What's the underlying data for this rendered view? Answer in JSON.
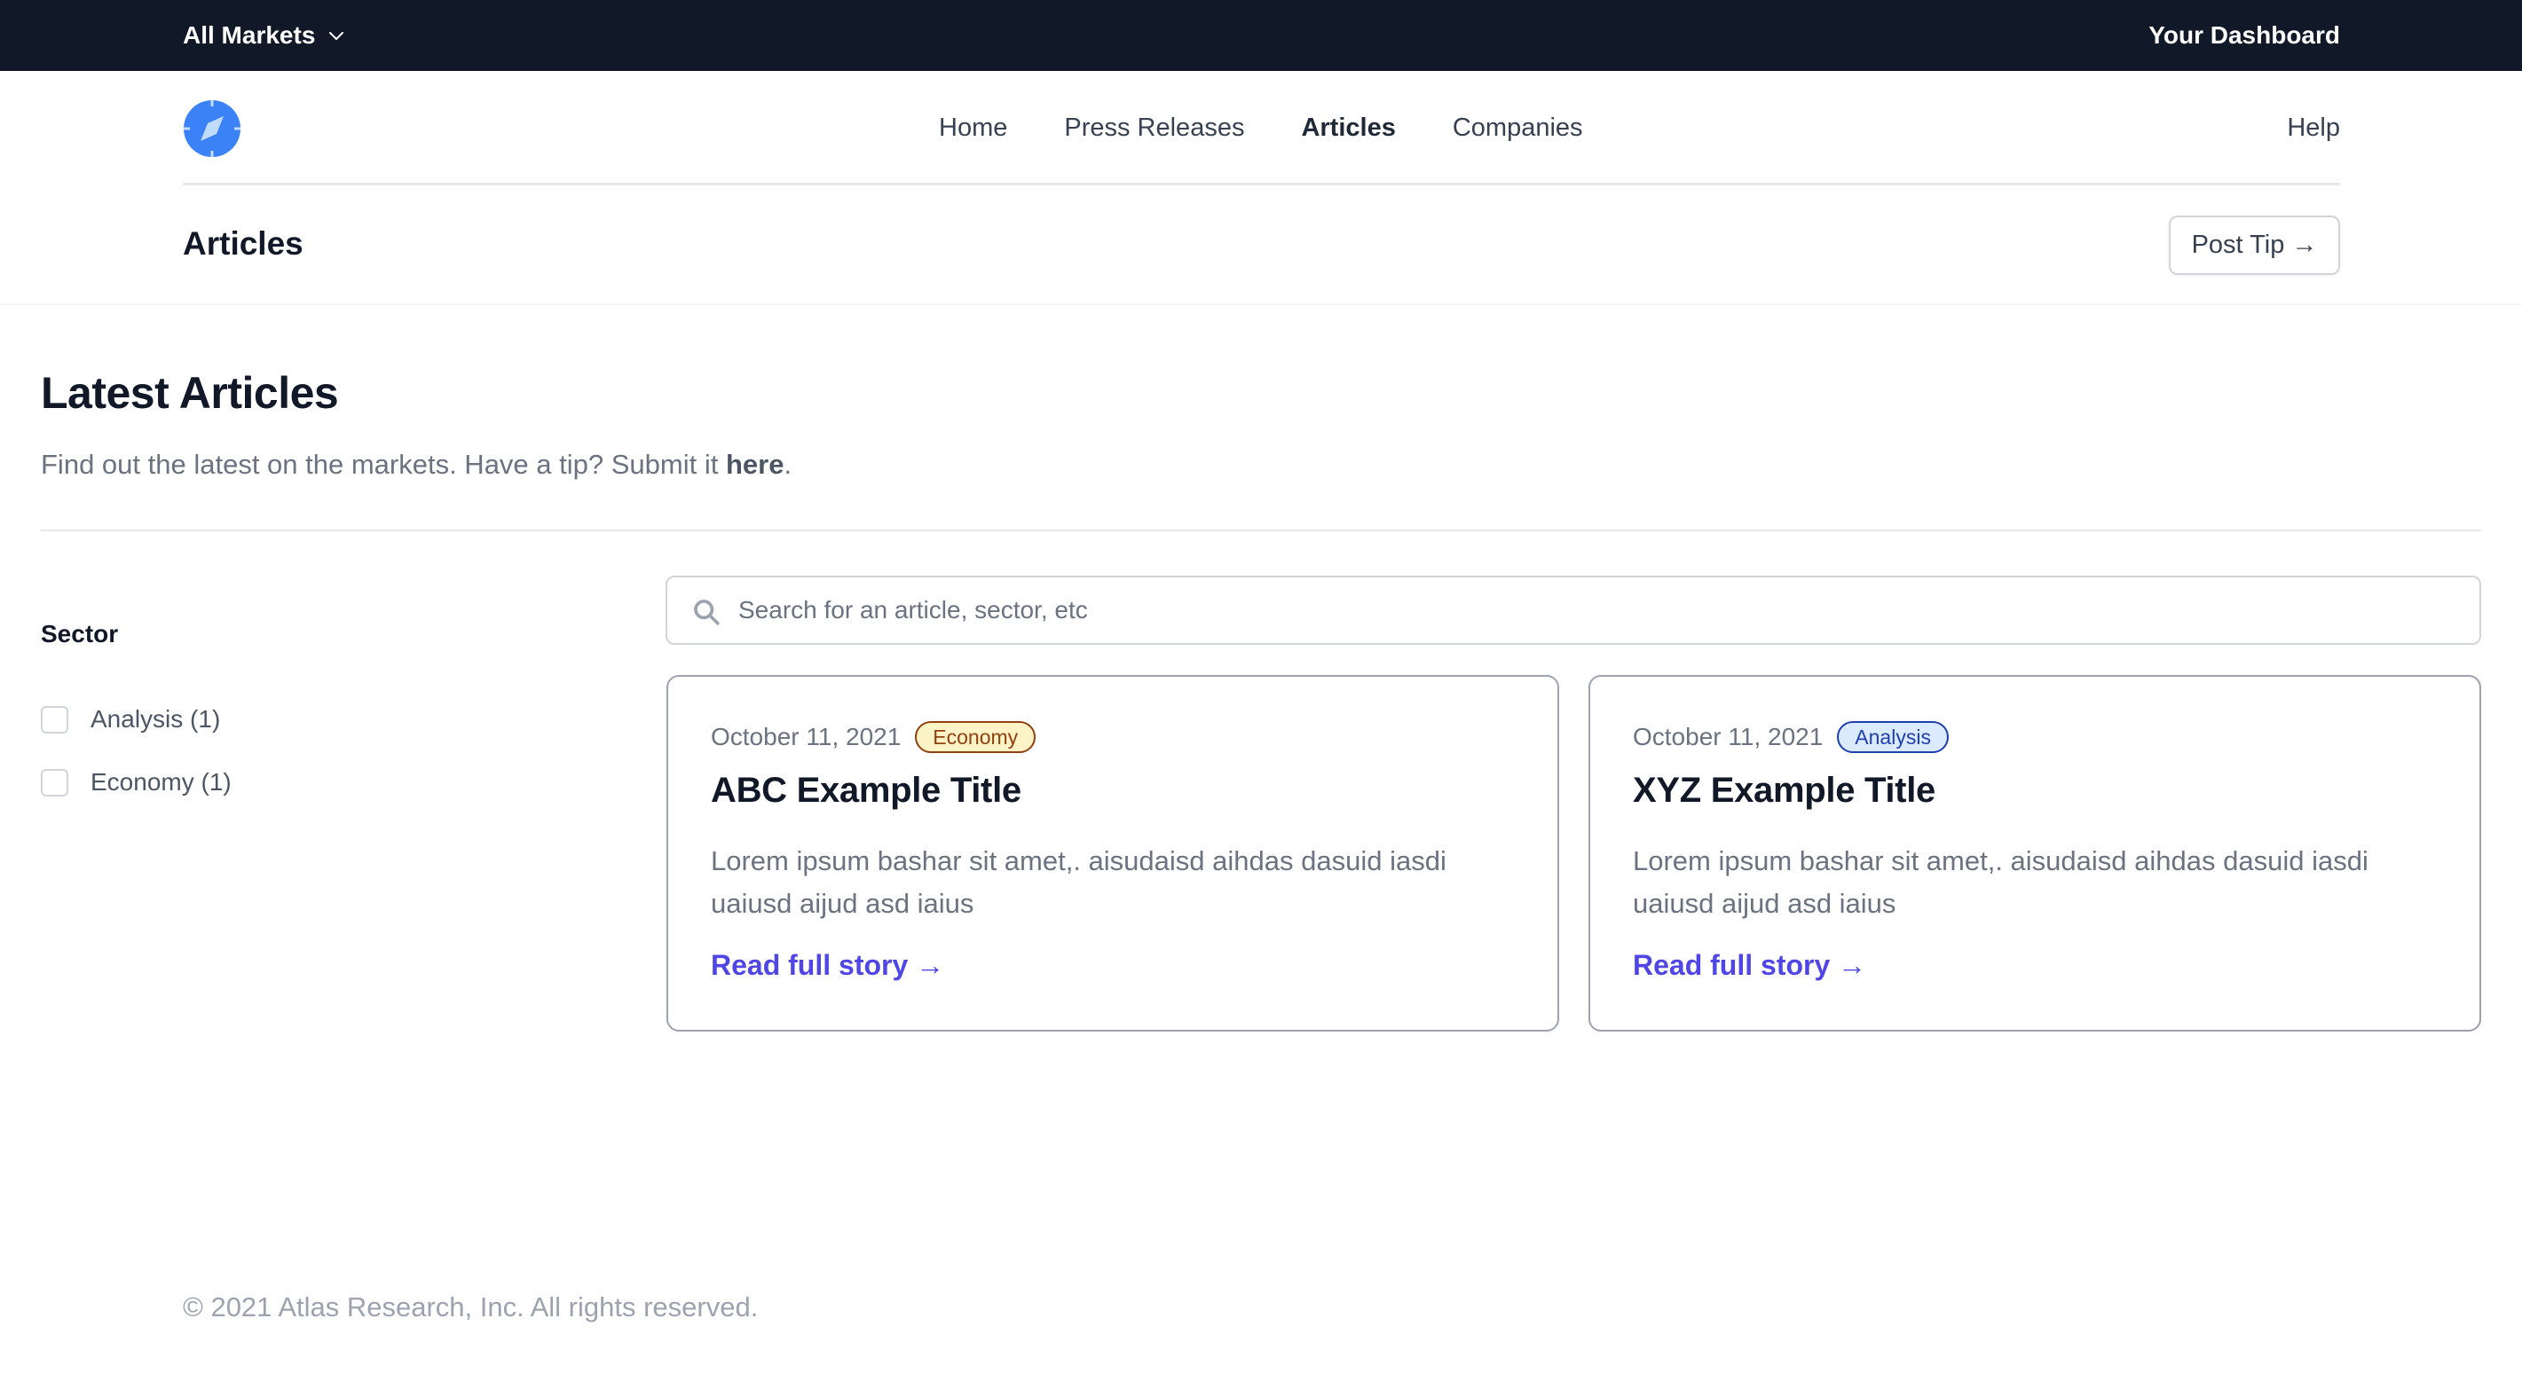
{
  "topbar": {
    "market_selector": "All Markets",
    "dashboard_link": "Your Dashboard"
  },
  "navbar": {
    "links": [
      {
        "label": "Home",
        "active": false
      },
      {
        "label": "Press Releases",
        "active": false
      },
      {
        "label": "Articles",
        "active": true
      },
      {
        "label": "Companies",
        "active": false
      }
    ],
    "help": "Help"
  },
  "page_header": {
    "title": "Articles",
    "post_tip_button": "Post Tip →"
  },
  "main": {
    "title": "Latest Articles",
    "subtitle_prefix": "Find out the latest on the markets. Have a tip? Submit it ",
    "subtitle_link": "here",
    "subtitle_suffix": "."
  },
  "filters": {
    "heading": "Sector",
    "options": [
      {
        "label": "Analysis (1)",
        "checked": false
      },
      {
        "label": "Economy (1)",
        "checked": false
      }
    ]
  },
  "search": {
    "placeholder": "Search for an article, sector, etc",
    "value": ""
  },
  "articles": [
    {
      "date": "October 11, 2021",
      "sector": "Economy",
      "title": "ABC Example Title",
      "description": "Lorem ipsum bashar sit amet,. aisudaisd aihdas dasuid iasdi uaiusd aijud asd iaius",
      "link": "Read full story →"
    },
    {
      "date": "October 11, 2021",
      "sector": "Analysis",
      "title": "XYZ Example Title",
      "description": "Lorem ipsum bashar sit amet,. aisudaisd aihdas dasuid iasdi uaiusd aijud asd iaius",
      "link": "Read full story →"
    }
  ],
  "footer": {
    "copyright": "© 2021 Atlas Research, Inc. All rights reserved."
  },
  "colors": {
    "topbar_bg": "#111827",
    "brand_blue": "#3b82f6",
    "link_accent": "#4f46e5",
    "economy_badge": "#fef3c7",
    "analysis_badge": "#dbeafe"
  }
}
